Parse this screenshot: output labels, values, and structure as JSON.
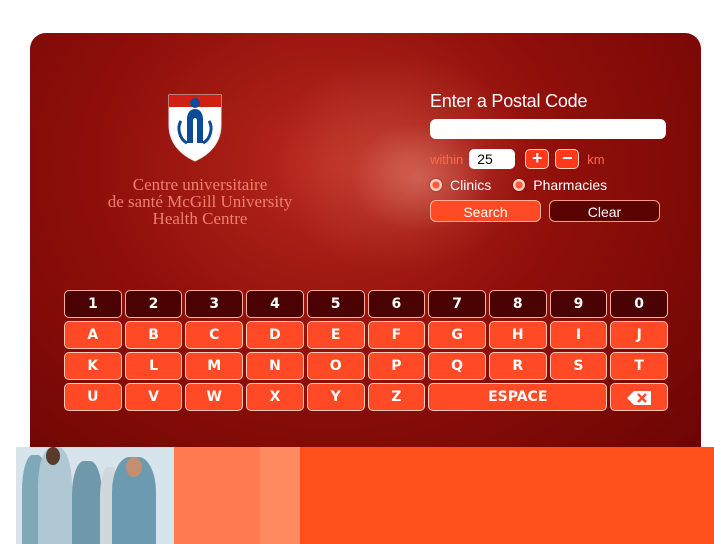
{
  "org": {
    "line1": "Centre universitaire",
    "line2": "de santé McGill University",
    "line3": "Health Centre",
    "logo_icon": "muhc-shield-logo"
  },
  "form": {
    "title": "Enter a Postal Code",
    "postal_value": "",
    "within_label": "within",
    "radius_value": "25",
    "plus_label": "+",
    "minus_label": "−",
    "km_label": "km",
    "radio_clinics": "Clinics",
    "radio_pharmacies": "Pharmacies",
    "search_label": "Search",
    "clear_label": "Clear"
  },
  "keyboard": {
    "row1": [
      "1",
      "2",
      "3",
      "4",
      "5",
      "6",
      "7",
      "8",
      "9",
      "0"
    ],
    "row2": [
      "A",
      "B",
      "C",
      "D",
      "E",
      "F",
      "G",
      "H",
      "I",
      "J"
    ],
    "row3": [
      "K",
      "L",
      "M",
      "N",
      "O",
      "P",
      "Q",
      "R",
      "S",
      "T"
    ],
    "row4": [
      "U",
      "V",
      "W",
      "X",
      "Y",
      "Z"
    ],
    "space_label": "ESPACE",
    "backspace_icon": "backspace-icon"
  },
  "colors": {
    "panel": "#8f0f0a",
    "accent": "#ff4a25",
    "key_dark": "#4a0202"
  }
}
